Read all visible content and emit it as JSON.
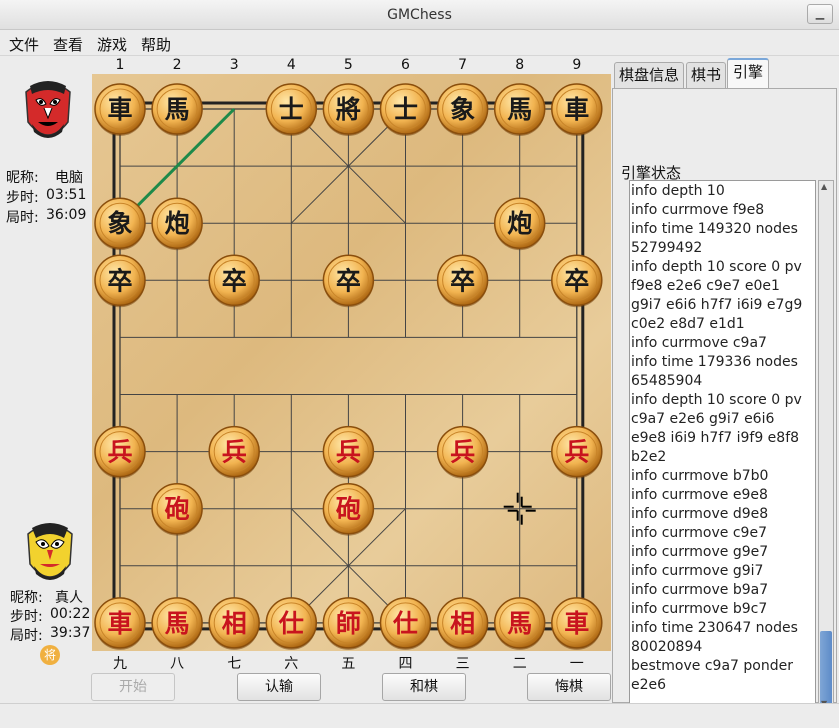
{
  "window": {
    "title": "GMChess",
    "minimize_icon": "minimize-icon"
  },
  "menu": [
    "文件",
    "查看",
    "游戏",
    "帮助"
  ],
  "top_player": {
    "nick_label": "昵称:",
    "nick": "电脑",
    "step_label": "步时:",
    "step_time": "03:51",
    "game_label": "局时:",
    "game_time": "36:09"
  },
  "bottom_player": {
    "nick_label": "昵称:",
    "nick": "真人",
    "step_label": "步时:",
    "step_time": "00:22",
    "game_label": "局时:",
    "game_time": "39:37",
    "badge": "将"
  },
  "board": {
    "file_labels_top": [
      "1",
      "2",
      "3",
      "4",
      "5",
      "6",
      "7",
      "8",
      "9"
    ],
    "file_labels_bottom": [
      "九",
      "八",
      "七",
      "六",
      "五",
      "四",
      "三",
      "二",
      "一"
    ],
    "last_move_line_color": "#1e8a4a",
    "pieces": [
      {
        "col": 0,
        "row": 0,
        "char": "車",
        "side": "black"
      },
      {
        "col": 1,
        "row": 0,
        "char": "馬",
        "side": "black"
      },
      {
        "col": 3,
        "row": 0,
        "char": "士",
        "side": "black"
      },
      {
        "col": 4,
        "row": 0,
        "char": "將",
        "side": "black"
      },
      {
        "col": 5,
        "row": 0,
        "char": "士",
        "side": "black"
      },
      {
        "col": 6,
        "row": 0,
        "char": "象",
        "side": "black"
      },
      {
        "col": 7,
        "row": 0,
        "char": "馬",
        "side": "black"
      },
      {
        "col": 8,
        "row": 0,
        "char": "車",
        "side": "black"
      },
      {
        "col": 0,
        "row": 2,
        "char": "象",
        "side": "black"
      },
      {
        "col": 1,
        "row": 2,
        "char": "炮",
        "side": "black"
      },
      {
        "col": 7,
        "row": 2,
        "char": "炮",
        "side": "black"
      },
      {
        "col": 0,
        "row": 3,
        "char": "卒",
        "side": "black"
      },
      {
        "col": 2,
        "row": 3,
        "char": "卒",
        "side": "black"
      },
      {
        "col": 4,
        "row": 3,
        "char": "卒",
        "side": "black"
      },
      {
        "col": 6,
        "row": 3,
        "char": "卒",
        "side": "black"
      },
      {
        "col": 8,
        "row": 3,
        "char": "卒",
        "side": "black"
      },
      {
        "col": 0,
        "row": 6,
        "char": "兵",
        "side": "red"
      },
      {
        "col": 2,
        "row": 6,
        "char": "兵",
        "side": "red"
      },
      {
        "col": 4,
        "row": 6,
        "char": "兵",
        "side": "red"
      },
      {
        "col": 6,
        "row": 6,
        "char": "兵",
        "side": "red"
      },
      {
        "col": 8,
        "row": 6,
        "char": "兵",
        "side": "red"
      },
      {
        "col": 1,
        "row": 7,
        "char": "砲",
        "side": "red"
      },
      {
        "col": 4,
        "row": 7,
        "char": "砲",
        "side": "red"
      },
      {
        "col": 0,
        "row": 9,
        "char": "車",
        "side": "red"
      },
      {
        "col": 1,
        "row": 9,
        "char": "馬",
        "side": "red"
      },
      {
        "col": 2,
        "row": 9,
        "char": "相",
        "side": "red"
      },
      {
        "col": 3,
        "row": 9,
        "char": "仕",
        "side": "red"
      },
      {
        "col": 4,
        "row": 9,
        "char": "師",
        "side": "red"
      },
      {
        "col": 5,
        "row": 9,
        "char": "仕",
        "side": "red"
      },
      {
        "col": 6,
        "row": 9,
        "char": "相",
        "side": "red"
      },
      {
        "col": 7,
        "row": 9,
        "char": "馬",
        "side": "red"
      },
      {
        "col": 8,
        "row": 9,
        "char": "車",
        "side": "red"
      }
    ],
    "last_move": {
      "from": {
        "col": 2,
        "row": 0
      },
      "to": {
        "col": 0,
        "row": 2
      }
    },
    "cursor": {
      "col": 7,
      "row": 7
    }
  },
  "buttons": {
    "start": "开始",
    "resign": "认输",
    "draw": "和棋",
    "undo": "悔棋"
  },
  "tabs": [
    "棋盘信息",
    "棋书",
    "引擎"
  ],
  "engine": {
    "status_label": "引擎状态",
    "log": [
      "info depth 10",
      "info currmove f9e8",
      "info time 149320 nodes",
      "52799492",
      "info depth 10 score 0 pv",
      "f9e8 e2e6 c9e7 e0e1",
      "g9i7 e6i6 h7f7 i6i9 e7g9",
      "c0e2 e8d7 e1d1",
      "info currmove c9a7",
      "info time 179336 nodes",
      "65485904",
      "info depth 10 score 0 pv",
      "c9a7 e2e6 g9i7 e6i6",
      "e9e8 i6i9 h7f7 i9f9 e8f8",
      "b2e2",
      "info currmove b7b0",
      "info currmove e9e8",
      "info currmove d9e8",
      "info currmove c9e7",
      "info currmove g9e7",
      "info currmove g9i7",
      "info currmove b9a7",
      "info currmove b9c7",
      "info time 230647 nodes",
      "80020894",
      "bestmove c9a7 ponder",
      "e2e6"
    ]
  }
}
